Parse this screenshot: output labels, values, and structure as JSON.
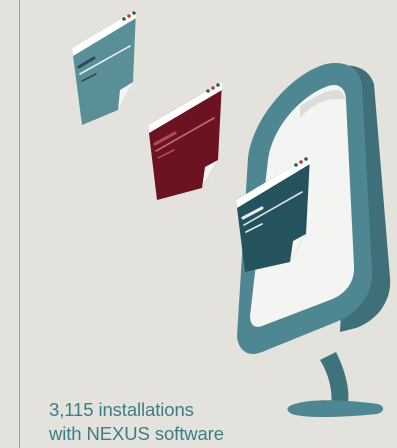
{
  "caption": {
    "line1": "3,115 installations",
    "line2": "with NEXUS software"
  },
  "colors": {
    "background": "#e3e2dd",
    "teal_light": "#5b8f97",
    "teal_dark": "#24535e",
    "maroon": "#6b1320",
    "monitor": "#4e8791",
    "caption_text": "#3e7d86"
  },
  "icons": [
    "document-window-icon",
    "monitor-icon"
  ]
}
